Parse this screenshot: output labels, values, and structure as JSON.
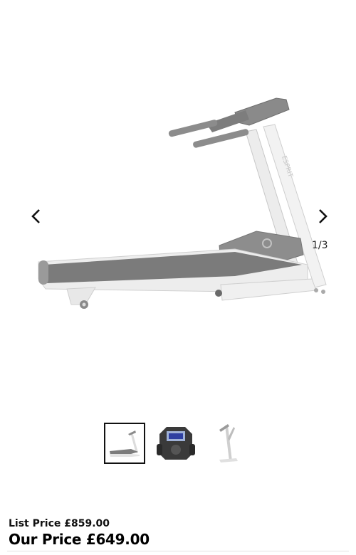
{
  "gallery": {
    "main_image": "treadmill-side-view",
    "prev_icon": "chevron-left-icon",
    "next_icon": "chevron-right-icon",
    "counter": "1/3",
    "thumbnails": [
      {
        "name": "treadmill-side-thumbnail",
        "selected": true
      },
      {
        "name": "treadmill-console-thumbnail",
        "selected": false
      },
      {
        "name": "treadmill-folded-thumbnail",
        "selected": false
      }
    ]
  },
  "pricing": {
    "list_price": "List Price £859.00",
    "our_price": "Our Price £649.00"
  },
  "colors": {
    "text": "#111111",
    "frame": "#e9e9e9",
    "belt": "#7f7f7f"
  }
}
